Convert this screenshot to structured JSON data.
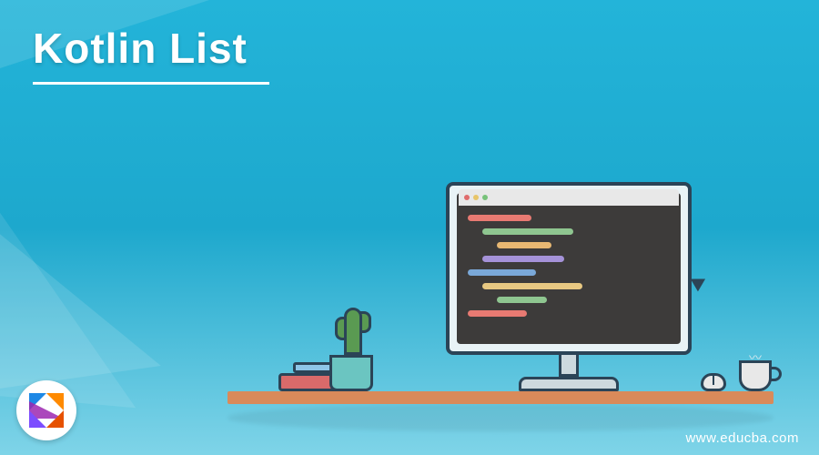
{
  "title": "Kotlin List",
  "watermark": "www.educba.com",
  "logo_name": "kotlin-logo",
  "colors": {
    "bg_top": "#23b4d9",
    "bg_bottom": "#7fd4e8",
    "desk": "#d98a5a",
    "outline": "#2b4457"
  }
}
